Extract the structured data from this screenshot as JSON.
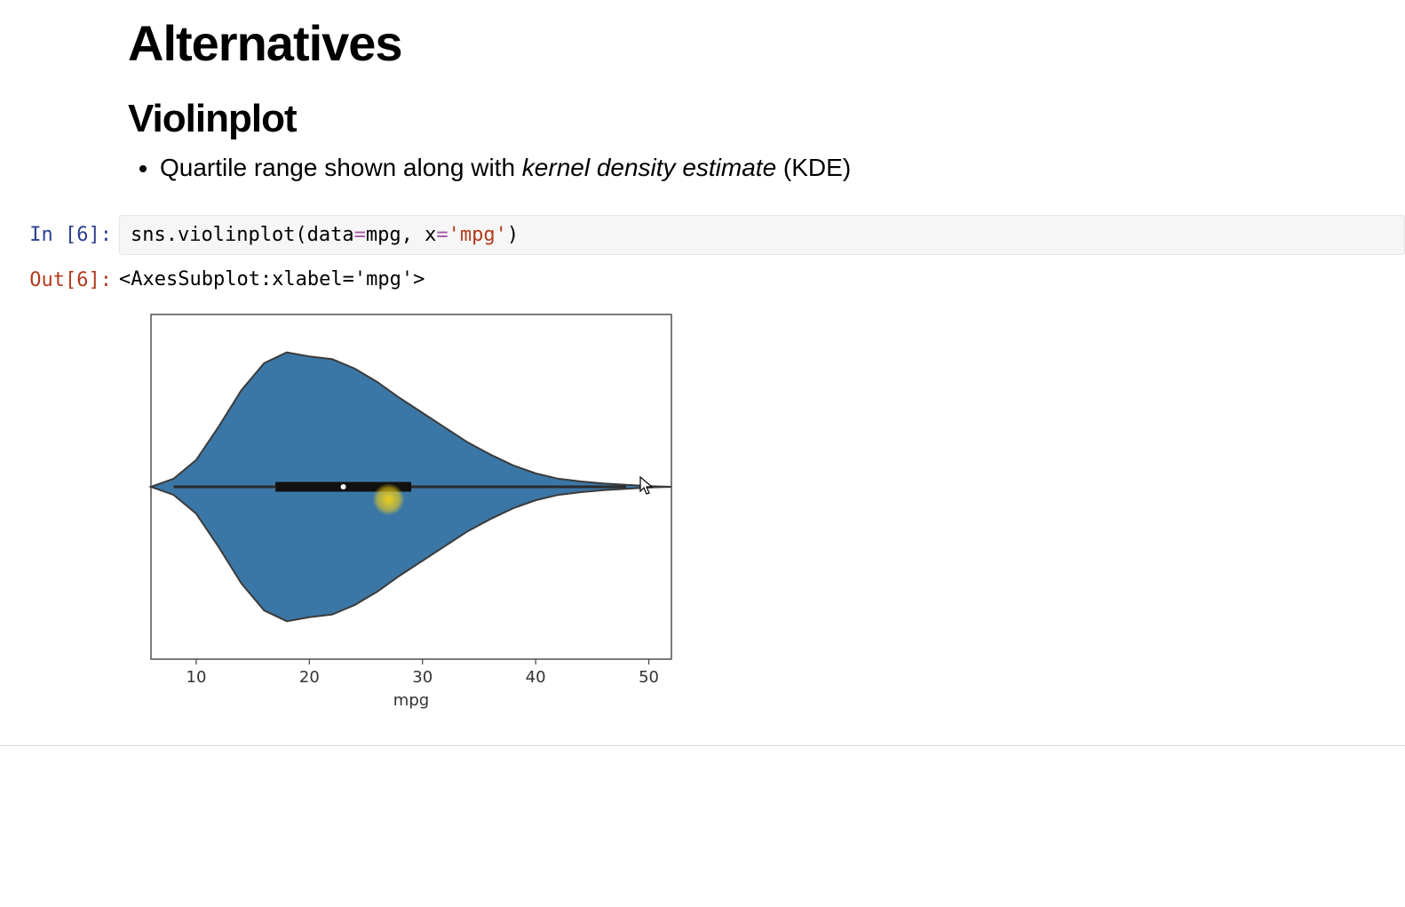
{
  "heading": "Alternatives",
  "subheading": "Violinplot",
  "bullet_pre": "Quartile range shown along with ",
  "bullet_em": "kernel density estimate",
  "bullet_post": " (KDE)",
  "prompt_in": "In [6]:",
  "prompt_out": "Out[6]:",
  "code": {
    "p0": "sns.violinplot(data",
    "p1": "=",
    "p2": "mpg, x",
    "p3": "=",
    "p4": "'mpg'",
    "p5": ")"
  },
  "output_text": "<AxesSubplot:xlabel='mpg'>",
  "chart_data": {
    "type": "violin",
    "xlabel": "mpg",
    "x_ticks": [
      10,
      20,
      30,
      40,
      50
    ],
    "x_range": [
      6,
      52
    ],
    "median": 23,
    "q1": 17,
    "q3": 29,
    "whisker_lo": 8,
    "whisker_hi": 48,
    "kde": [
      {
        "x": 6,
        "h": 0.0
      },
      {
        "x": 8,
        "h": 0.06
      },
      {
        "x": 10,
        "h": 0.2
      },
      {
        "x": 12,
        "h": 0.45
      },
      {
        "x": 14,
        "h": 0.72
      },
      {
        "x": 16,
        "h": 0.92
      },
      {
        "x": 18,
        "h": 1.0
      },
      {
        "x": 20,
        "h": 0.97
      },
      {
        "x": 22,
        "h": 0.95
      },
      {
        "x": 24,
        "h": 0.88
      },
      {
        "x": 26,
        "h": 0.78
      },
      {
        "x": 28,
        "h": 0.66
      },
      {
        "x": 30,
        "h": 0.55
      },
      {
        "x": 32,
        "h": 0.44
      },
      {
        "x": 34,
        "h": 0.33
      },
      {
        "x": 36,
        "h": 0.24
      },
      {
        "x": 38,
        "h": 0.16
      },
      {
        "x": 40,
        "h": 0.1
      },
      {
        "x": 42,
        "h": 0.06
      },
      {
        "x": 44,
        "h": 0.04
      },
      {
        "x": 46,
        "h": 0.025
      },
      {
        "x": 48,
        "h": 0.015
      },
      {
        "x": 50,
        "h": 0.005
      },
      {
        "x": 52,
        "h": 0.0
      }
    ],
    "fill_color": "#3b77a6",
    "stroke_color": "#3b3b3b",
    "highlight_marker": {
      "x": 27,
      "y_offset": 14,
      "color": "#f5d116"
    }
  }
}
